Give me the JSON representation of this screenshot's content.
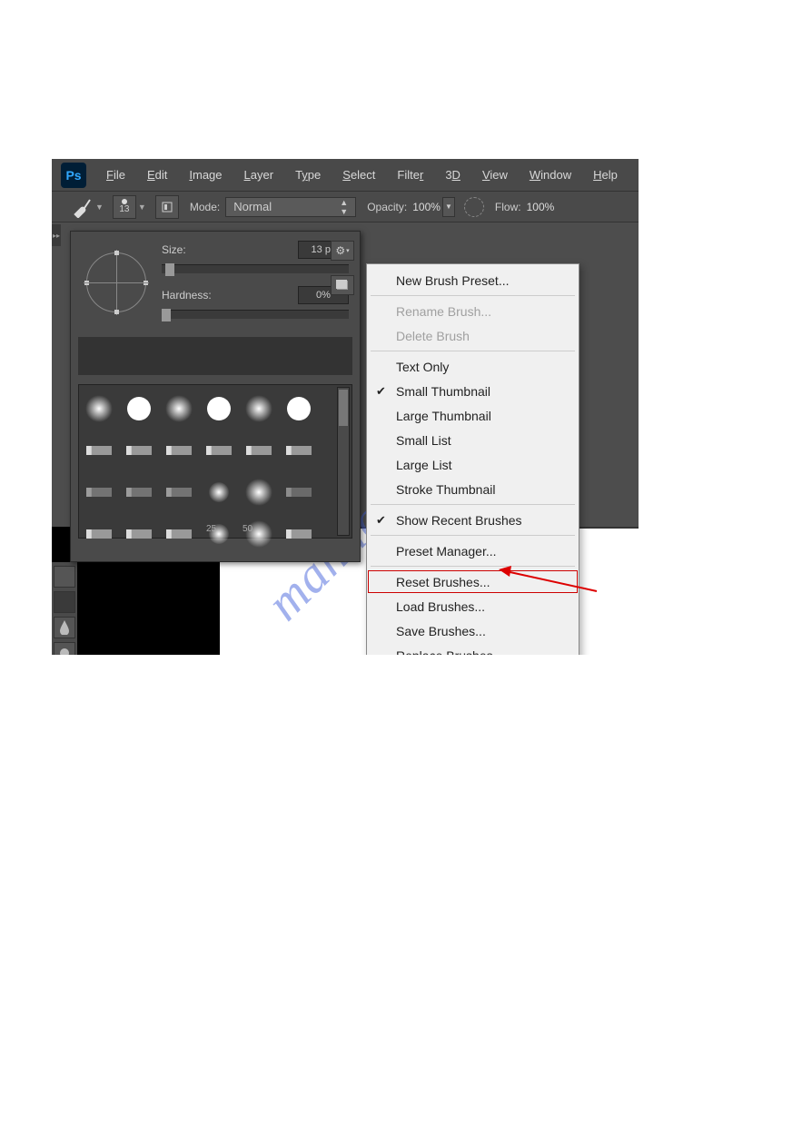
{
  "menubar": {
    "logo": "Ps",
    "items": [
      "File",
      "Edit",
      "Image",
      "Layer",
      "Type",
      "Select",
      "Filter",
      "3D",
      "View",
      "Window",
      "Help"
    ]
  },
  "optbar": {
    "brush_num": "13",
    "mode_label": "Mode:",
    "mode_value": "Normal",
    "opacity_label": "Opacity:",
    "opacity_value": "100%",
    "flow_label": "Flow:",
    "flow_value": "100%"
  },
  "brush_panel": {
    "size_label": "Size:",
    "size_value": "13 px",
    "hardness_label": "Hardness:",
    "hardness_value": "0%",
    "gear_icon": "⚙",
    "caption_25": "25",
    "caption_50": "50"
  },
  "ctx": {
    "new_preset": "New Brush Preset...",
    "rename": "Rename Brush...",
    "delete": "Delete Brush",
    "text_only": "Text Only",
    "small_thumb": "Small Thumbnail",
    "large_thumb": "Large Thumbnail",
    "small_list": "Small List",
    "large_list": "Large List",
    "stroke_thumb": "Stroke Thumbnail",
    "show_recent": "Show Recent Brushes",
    "preset_mgr": "Preset Manager...",
    "reset": "Reset Brushes...",
    "load": "Load Brushes...",
    "save": "Save Brushes...",
    "replace": "Replace Brushes...",
    "check": "✔"
  },
  "watermark": "manualshive.com"
}
